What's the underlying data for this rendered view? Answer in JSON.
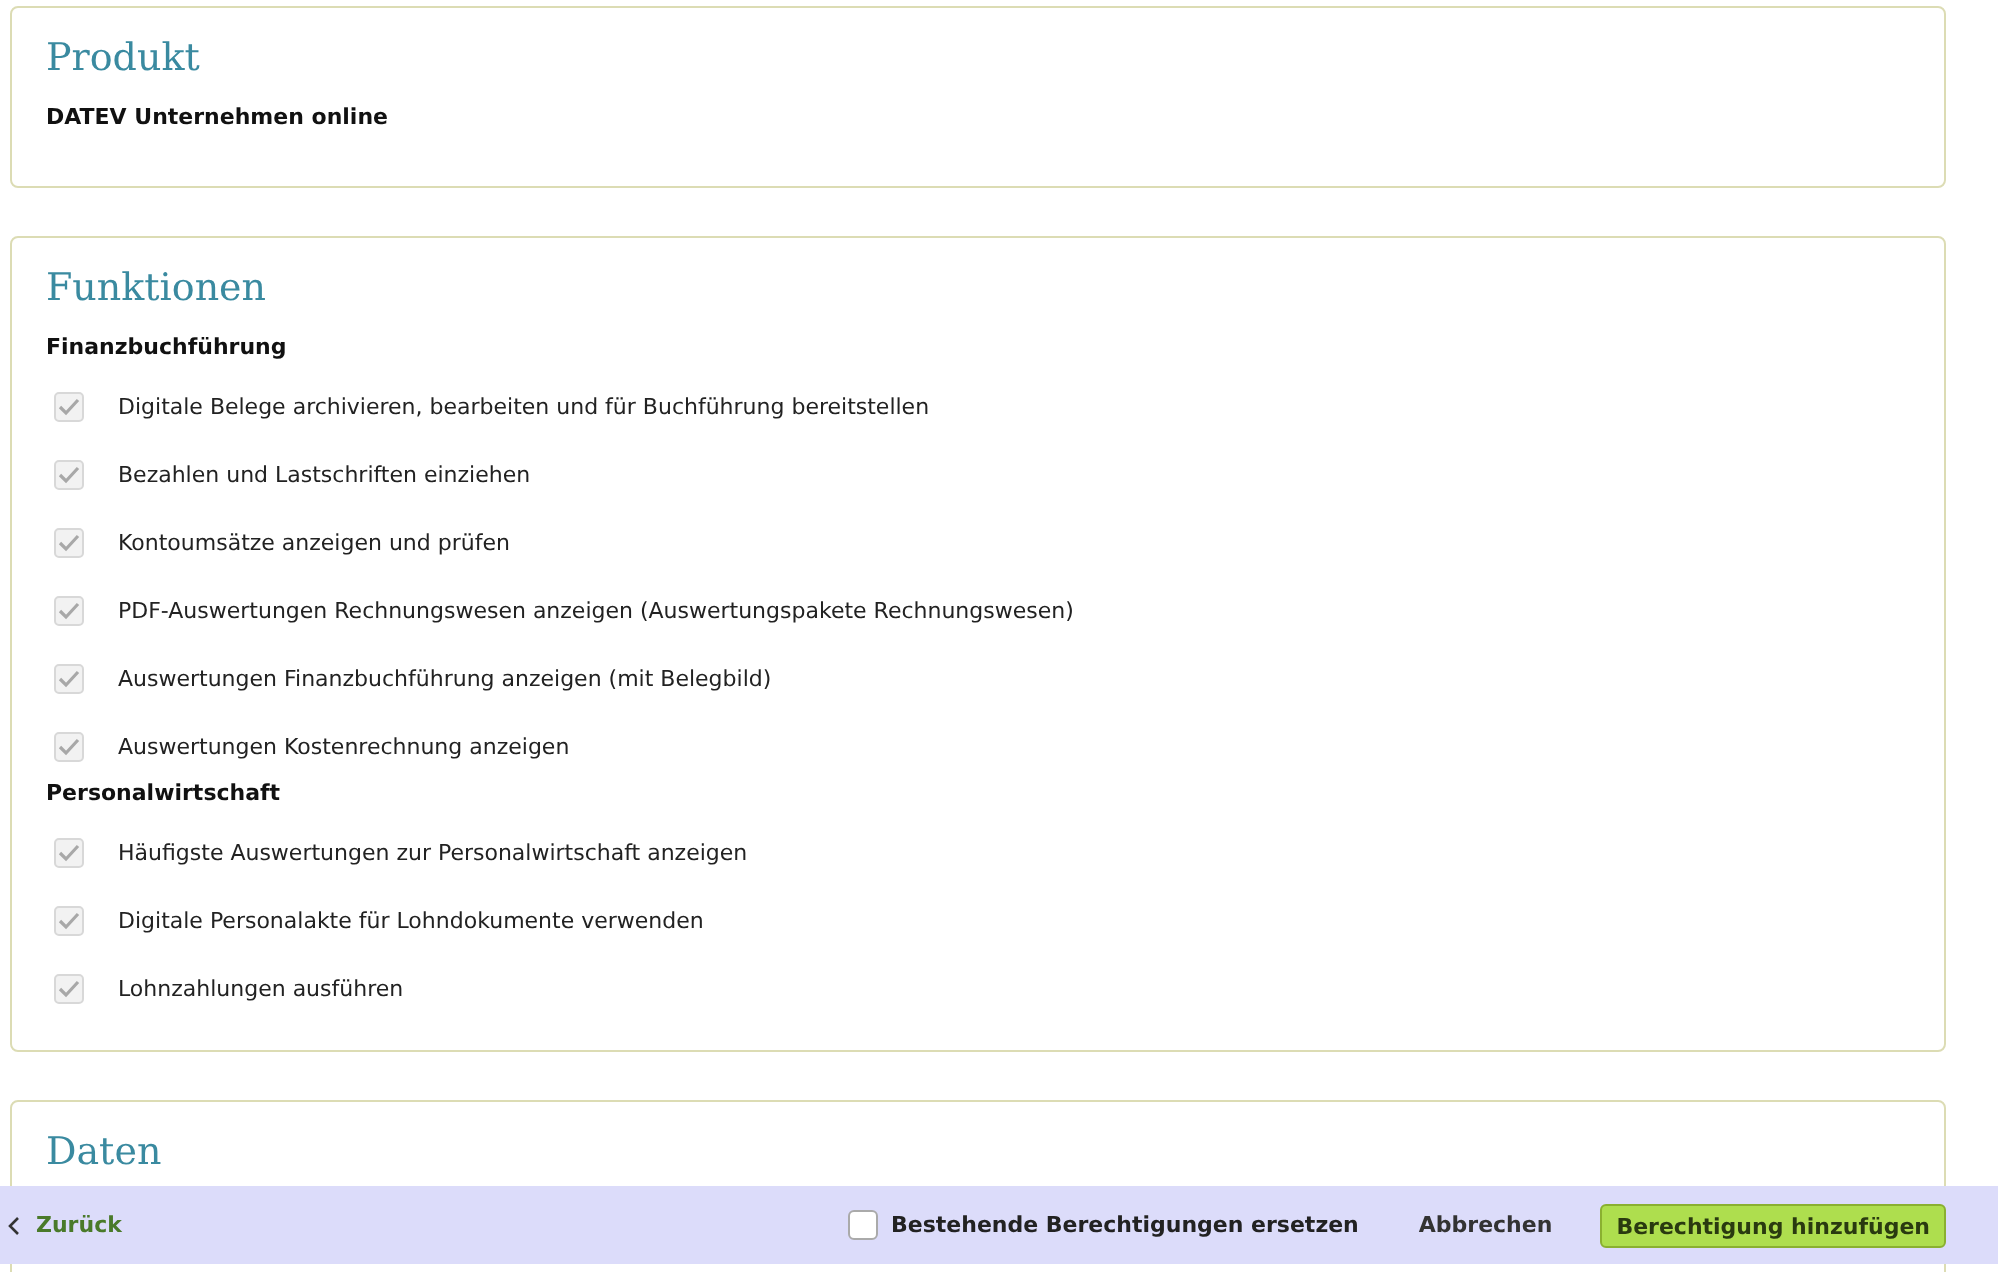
{
  "product": {
    "title": "Produkt",
    "name": "DATEV Unternehmen online"
  },
  "functions": {
    "title": "Funktionen",
    "groups": [
      {
        "title": "Finanzbuchführung",
        "items": [
          {
            "label": "Digitale Belege archivieren, bearbeiten und für Buchführung bereitstellen",
            "checked": true
          },
          {
            "label": "Bezahlen und Lastschriften einziehen",
            "checked": true
          },
          {
            "label": "Kontoumsätze anzeigen und prüfen",
            "checked": true
          },
          {
            "label": "PDF-Auswertungen Rechnungswesen anzeigen (Auswertungspakete Rechnungswesen)",
            "checked": true
          },
          {
            "label": "Auswertungen Finanzbuchführung anzeigen (mit Belegbild)",
            "checked": true
          },
          {
            "label": "Auswertungen Kostenrechnung anzeigen",
            "checked": true
          }
        ]
      },
      {
        "title": "Personalwirtschaft",
        "items": [
          {
            "label": "Häufigste Auswertungen zur Personalwirtschaft anzeigen",
            "checked": true
          },
          {
            "label": "Digitale Personalakte für Lohndokumente verwenden",
            "checked": true
          },
          {
            "label": "Lohnzahlungen ausführen",
            "checked": true
          }
        ]
      }
    ]
  },
  "data_section": {
    "title": "Daten"
  },
  "footer": {
    "back": "Zurück",
    "replace": {
      "label": "Bestehende Berechtigungen ersetzen",
      "checked": false
    },
    "cancel": "Abbrechen",
    "submit": "Berechtigung hinzufügen"
  }
}
